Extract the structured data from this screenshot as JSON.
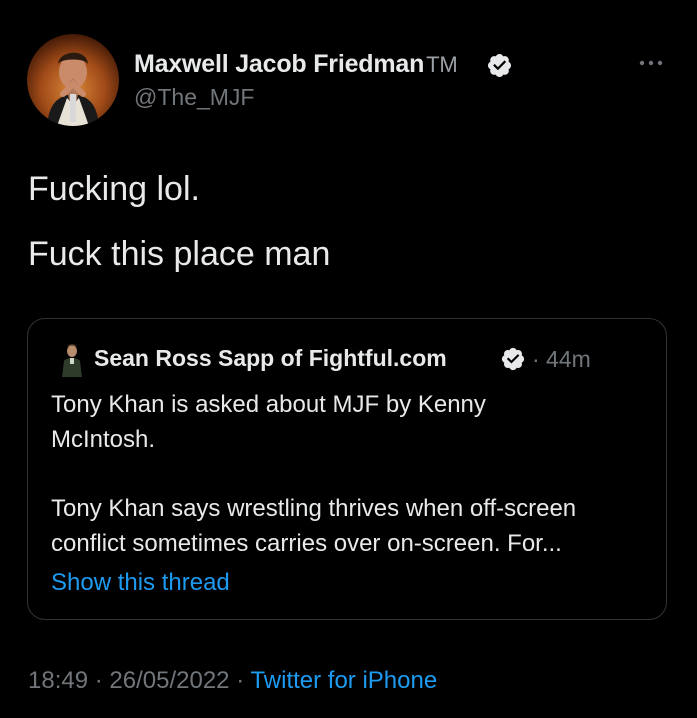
{
  "tweet": {
    "author_name": "Maxwell Jacob Friedman",
    "author_tm": "TM",
    "handle": "@The_MJF",
    "text_lines": [
      "Fucking lol.",
      "Fuck this place man"
    ],
    "time": "18:49",
    "separator": "·",
    "date": "26/05/2022",
    "source": "Twitter for iPhone"
  },
  "quoted": {
    "author_name": "Sean Ross Sapp of Fightful.com",
    "time": "· 44m",
    "text_lines": [
      "Tony Khan is asked about MJF by Kenny",
      "McIntosh.",
      "Tony Khan says wrestling thrives when off-screen",
      "conflict sometimes carries over on-screen. For..."
    ],
    "show_thread_label": "Show this thread"
  },
  "icons": {
    "verified": "verified-badge-icon",
    "more": "more-options-icon"
  },
  "colors": {
    "background": "#000000",
    "text": "#e7e9ea",
    "secondary": "#71767b",
    "link": "#1d9bf0",
    "border": "#2f3336"
  }
}
